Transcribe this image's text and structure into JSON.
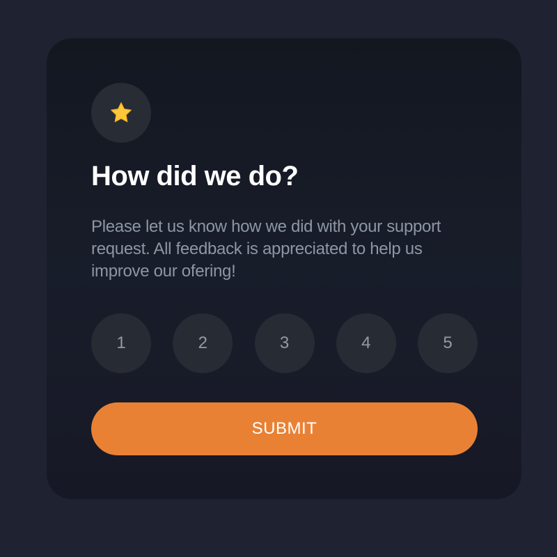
{
  "card": {
    "icon": "star-icon",
    "title": "How did we do?",
    "description": "Please let us know how we did with your support request. All feedback is appreciated to help us improve our ofering!",
    "ratings": [
      {
        "label": "1"
      },
      {
        "label": "2"
      },
      {
        "label": "3"
      },
      {
        "label": "4"
      },
      {
        "label": "5"
      }
    ],
    "submit_label": "SUBMIT"
  },
  "colors": {
    "page_background": "#1f2230",
    "card_background": "#161a24",
    "circle_background": "#262b34",
    "accent": "#e98135",
    "star": "#fcc73a",
    "muted_text": "#8e96a3"
  }
}
